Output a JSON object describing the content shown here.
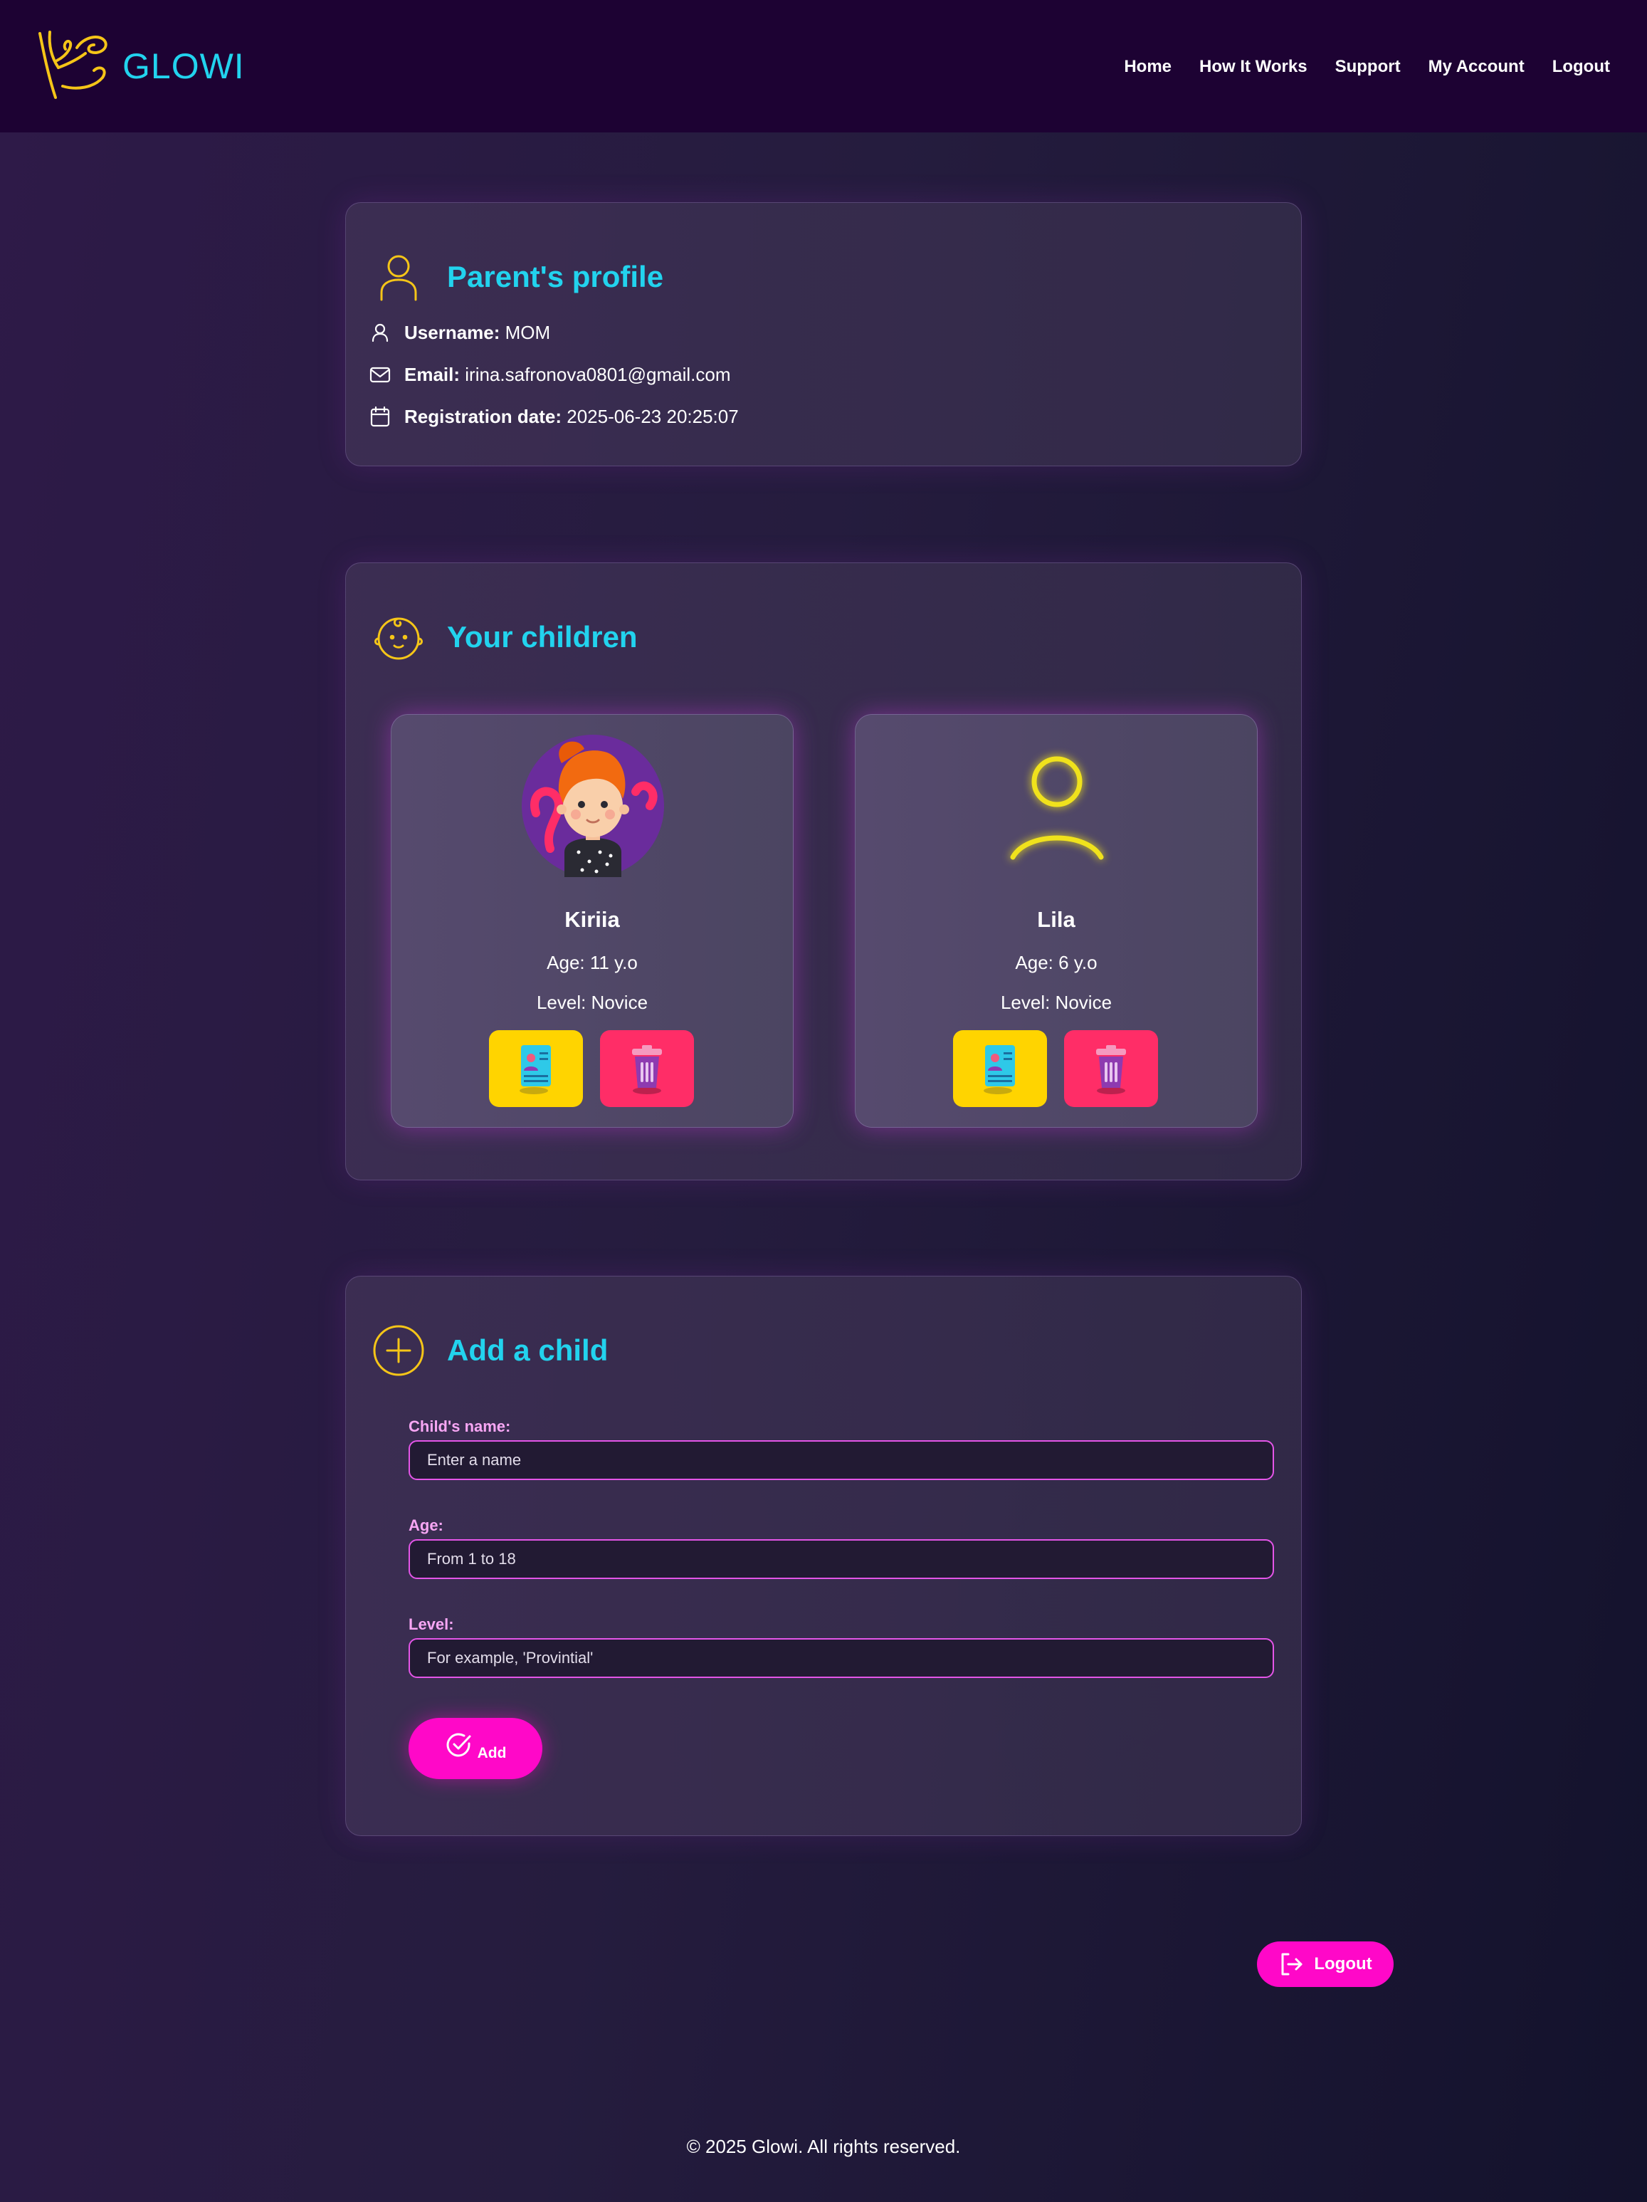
{
  "header": {
    "brand": "GLOWI",
    "nav": [
      "Home",
      "How It Works",
      "Support",
      "My Account",
      "Logout"
    ]
  },
  "profile": {
    "title": "Parent's profile",
    "username_label": "Username:",
    "username": "MOM",
    "email_label": "Email:",
    "email": "irina.safronova0801@gmail.com",
    "reg_label": "Registration date:",
    "reg_date": "2025-06-23 20:25:07"
  },
  "children": {
    "title": "Your children",
    "items": [
      {
        "name": "Kiriia",
        "age": "Age: 11 y.o",
        "level": "Level: Novice",
        "avatar": "girl-avatar"
      },
      {
        "name": "Lila",
        "age": "Age: 6 y.o",
        "level": "Level: Novice",
        "avatar": "user-outline-icon"
      }
    ]
  },
  "add_child": {
    "title": "Add a child",
    "name_label": "Child's name:",
    "name_placeholder": "Enter a name",
    "age_label": "Age:",
    "age_placeholder": "From 1 to 18",
    "level_label": "Level:",
    "level_placeholder": "For example, 'Provintial'",
    "submit_label": "Add"
  },
  "logout_button": "Logout",
  "footer": "© 2025 Glowi. All rights reserved.",
  "colors": {
    "accent_cyan": "#22d3ee",
    "accent_yellow": "#f5c518",
    "accent_pink": "#ff08c8",
    "delete_red": "#ff2d67",
    "doc_yellow": "#ffd400"
  }
}
